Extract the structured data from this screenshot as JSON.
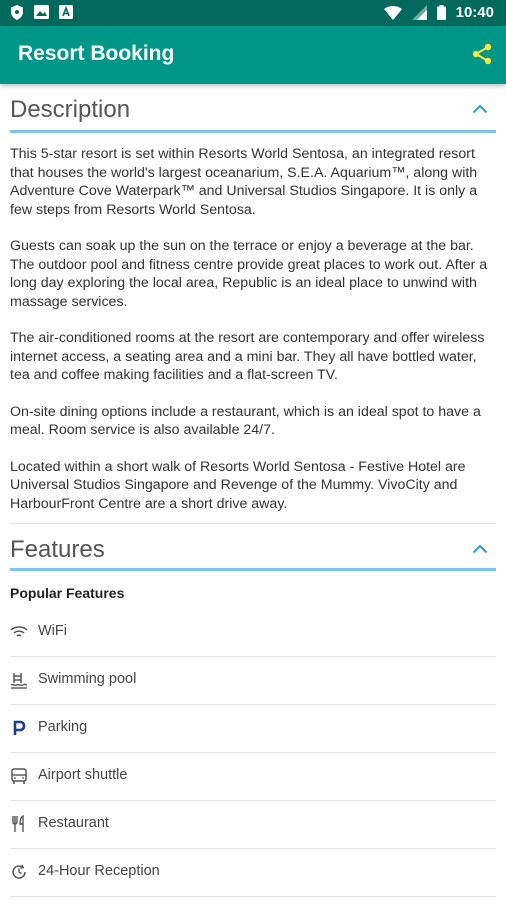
{
  "status_bar": {
    "time": "10:40"
  },
  "app_bar": {
    "title": "Resort Booking"
  },
  "description": {
    "title": "Description",
    "paragraphs": [
      "This 5-star resort is set within Resorts World Sentosa, an integrated resort that houses the world's largest oceanarium, S.E.A. Aquarium™, along with Adventure Cove Waterpark™ and Universal Studios Singapore. It is only a few steps from Resorts World Sentosa.",
      "Guests can soak up the sun on the terrace or enjoy a beverage at the bar. The outdoor pool and fitness centre provide great places to work out. After a long day exploring the local area, Republic is an ideal place to unwind with massage services.",
      "The air-conditioned rooms at the resort are contemporary and offer wireless internet access, a seating area and a mini bar. They all have bottled water, tea and coffee making facilities and a flat-screen TV.",
      "On-site dining options include a restaurant, which is an ideal spot to have a meal. Room service is also available 24/7.",
      "Located within a short walk of Resorts World Sentosa - Festive Hotel are Universal Studios Singapore and Revenge of the Mummy. VivoCity and HarbourFront Centre are a short drive away."
    ]
  },
  "features": {
    "title": "Features",
    "popular_label": "Popular Features",
    "items": [
      {
        "label": "WiFi",
        "icon": "wifi-icon"
      },
      {
        "label": "Swimming pool",
        "icon": "pool-icon"
      },
      {
        "label": "Parking",
        "icon": "parking-icon"
      },
      {
        "label": "Airport shuttle",
        "icon": "shuttle-icon"
      },
      {
        "label": "Restaurant",
        "icon": "restaurant-icon"
      },
      {
        "label": "24-Hour Reception",
        "icon": "reception-icon"
      }
    ]
  },
  "colors": {
    "status_bar": "#00695c",
    "app_bar": "#009688",
    "accent": "#2a9fd8",
    "share_icon": "#ffeb3b",
    "section_underline": "#7fc4ef"
  }
}
